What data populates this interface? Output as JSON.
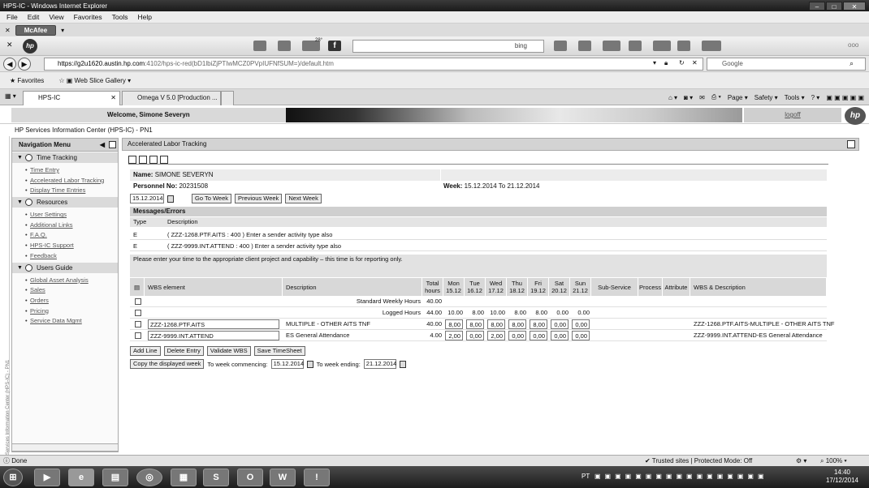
{
  "window": {
    "title": "HPS-IC - Windows Internet Explorer"
  },
  "menu": [
    "File",
    "Edit",
    "View",
    "Favorites",
    "Tools",
    "Help"
  ],
  "toolbar": {
    "mcafee": "McAfee",
    "weather_temp": "28°",
    "search_engine": "bing"
  },
  "address": {
    "host": "https://g2u1620.austin.hp.com",
    "path": ":4102/hps-ic-red(bD1lbiZjPTIwMCZ0PVpIUFNfSUM=)/default.htm",
    "search_placeholder": "Google"
  },
  "favbar": {
    "favorites": "Favorites",
    "web_slice": "Web Slice Gallery"
  },
  "tabs": [
    {
      "label": "HPS-IC"
    },
    {
      "label": "Omega V 5.0 [Production ..."
    }
  ],
  "commands": {
    "page": "Page",
    "safety": "Safety",
    "tools": "Tools"
  },
  "header": {
    "welcome": "Welcome, Simone Severyn",
    "logoff": "logoff",
    "hp": "hp"
  },
  "app_title": "HP Services Information Center (HPS-IC) - PN1",
  "vertical_label": "HP Services Information Center (HPS-IC) - PN1",
  "nav": {
    "title": "Navigation Menu",
    "groups": [
      {
        "label": "Time Tracking",
        "items": [
          "Time Entry",
          "Accelerated Labor Tracking",
          "Display Time Entries"
        ]
      },
      {
        "label": "Resources",
        "items": [
          "User Settings",
          "Additional Links",
          "F.A.Q.",
          "HPS-IC Support",
          "Feedback"
        ]
      },
      {
        "label": "Users Guide",
        "items": [
          "Global Asset Analysis",
          "Sales",
          "Orders",
          "Pricing",
          "Service Data Mgmt"
        ]
      }
    ]
  },
  "main": {
    "title": "Accelerated Labor Tracking",
    "name_label": "Name:",
    "name_value": "SIMONE SEVERYN",
    "personnel_label": "Personnel No:",
    "personnel_value": "20231508",
    "week_label": "Week:",
    "week_value": "15.12.2014 To 21.12.2014",
    "date_value": "15.12.2014",
    "go_to_week": "Go To Week",
    "previous_week": "Previous Week",
    "next_week": "Next Week",
    "messages_title": "Messages/Errors",
    "msg_cols": {
      "type": "Type",
      "description": "Description"
    },
    "messages": [
      {
        "type": "E",
        "text": "( ZZZ-1268.PTF.AITS : 400 ) Enter a sender activity type also"
      },
      {
        "type": "E",
        "text": "( ZZZ-9999.INT.ATTEND : 400 ) Enter a sender activity type also"
      }
    ],
    "info": "Please enter your time to the appropriate client project and capability – this time is for reporting only."
  },
  "timesheet": {
    "headers": {
      "wbs": "WBS element",
      "desc": "Description",
      "total": "Total hours",
      "days": [
        {
          "d": "Mon",
          "date": "15.12"
        },
        {
          "d": "Tue",
          "date": "16.12"
        },
        {
          "d": "Wed",
          "date": "17.12"
        },
        {
          "d": "Thu",
          "date": "18.12"
        },
        {
          "d": "Fri",
          "date": "19.12"
        },
        {
          "d": "Sat",
          "date": "20.12"
        },
        {
          "d": "Sun",
          "date": "21.12"
        }
      ],
      "subservice": "Sub-Service",
      "process": "Process",
      "attribute": "Attribute",
      "wbsdesc": "WBS & Description"
    },
    "standard": {
      "label": "Standard Weekly Hours",
      "total": "40.00"
    },
    "logged": {
      "label": "Logged Hours",
      "total": "44.00",
      "days": [
        "10.00",
        "8.00",
        "10.00",
        "8.00",
        "8.00",
        "0.00",
        "0.00"
      ]
    },
    "entries": [
      {
        "wbs": "ZZZ-1268.PTF.AITS",
        "desc": "MULTIPLE - OTHER AITS TNF",
        "total": "40.00",
        "days": [
          "8,00",
          "8,00",
          "8,00",
          "8,00",
          "8,00",
          "0,00",
          "0,00"
        ],
        "wbsdesc": "ZZZ-1268.PTF.AITS-MULTIPLE - OTHER AITS TNF"
      },
      {
        "wbs": "ZZZ-9999.INT.ATTEND",
        "desc": "ES General Attendance",
        "total": "4.00",
        "days": [
          "2,00",
          "0,00",
          "2,00",
          "0,00",
          "0,00",
          "0,00",
          "0,00"
        ],
        "wbsdesc": "ZZZ-9999.INT.ATTEND-ES General Attendance"
      }
    ],
    "buttons": {
      "add_line": "Add Line",
      "delete_entry": "Delete Entry",
      "validate": "Validate WBS",
      "save": "Save TimeSheet"
    },
    "copy": {
      "button": "Copy the displayed week",
      "commencing_label": "To week commencing:",
      "commencing": "15.12.2014",
      "ending_label": "To week ending:",
      "ending": "21.12.2014"
    }
  },
  "status": {
    "left": "Done",
    "zone": "Trusted sites | Protected Mode: Off",
    "zoom": "100%"
  },
  "taskbar": {
    "lang": "PT",
    "time": "14:40",
    "date": "17/12/2014"
  }
}
